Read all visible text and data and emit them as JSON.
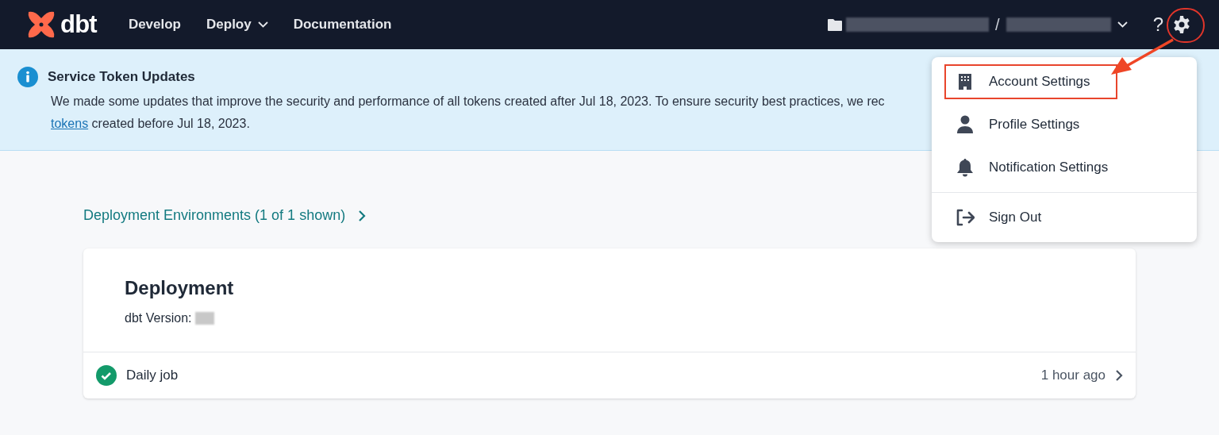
{
  "header": {
    "logo": "dbt",
    "nav": [
      {
        "label": "Develop",
        "dropdown": false
      },
      {
        "label": "Deploy",
        "dropdown": true
      },
      {
        "label": "Documentation",
        "dropdown": false
      }
    ],
    "separator": "/",
    "help": "?"
  },
  "banner": {
    "title": "Service Token Updates",
    "line_1": "We made some updates that improve the security and performance of all tokens created after Jul 18, 2023. To ensure security best practices, we rec",
    "link": "tokens",
    "line_2": "created before Jul 18, 2023."
  },
  "breadcrumb": "Deployment Environments (1 of 1 shown)",
  "card": {
    "title": "Deployment",
    "version_label": "dbt Version:",
    "job": {
      "name": "Daily job",
      "time": "1 hour ago"
    }
  },
  "menu": [
    {
      "label": "Account Settings",
      "kind": "building",
      "highlighted": true,
      "divider_before": false
    },
    {
      "label": "Profile Settings",
      "kind": "person",
      "highlighted": false,
      "divider_before": false
    },
    {
      "label": "Notification Settings",
      "kind": "bell",
      "highlighted": false,
      "divider_before": false
    },
    {
      "label": "Sign Out",
      "kind": "signout",
      "highlighted": false,
      "divider_before": true
    }
  ]
}
